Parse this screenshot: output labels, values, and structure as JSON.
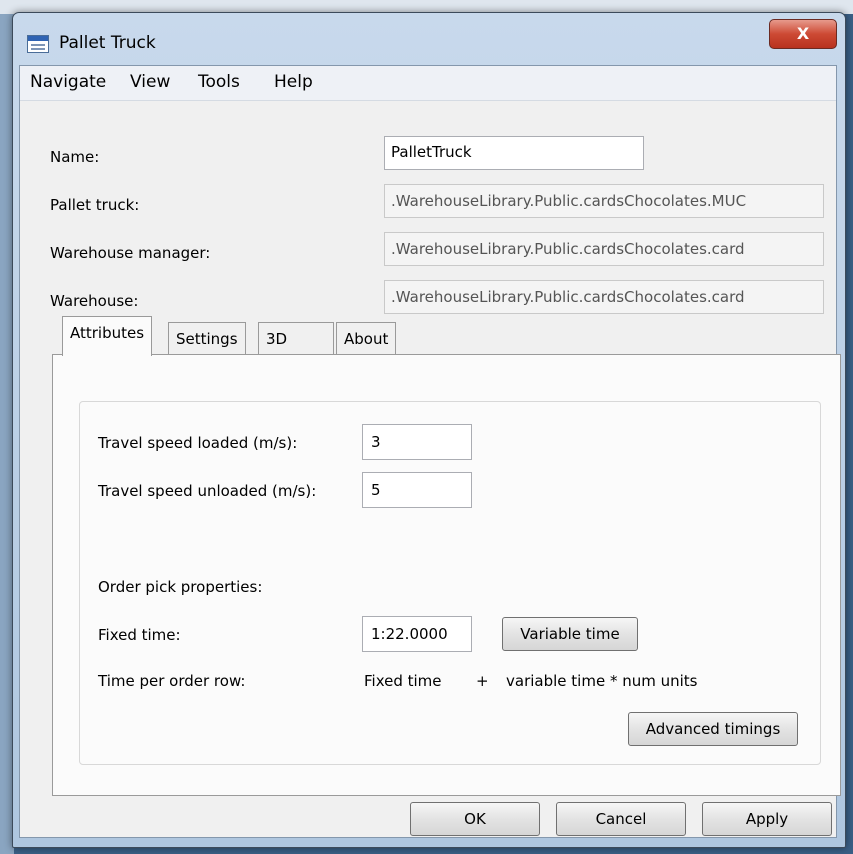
{
  "window": {
    "title": "Pallet Truck",
    "close_glyph": "X"
  },
  "menu": [
    "Navigate",
    "View",
    "Tools",
    "Help"
  ],
  "fields": {
    "name": {
      "label": "Name:",
      "value": "PalletTruck"
    },
    "pallet_truck": {
      "label": "Pallet truck:",
      "value": ".WarehouseLibrary.Public.cardsChocolates.MUC"
    },
    "warehouse_manager": {
      "label": "Warehouse manager:",
      "value": ".WarehouseLibrary.Public.cardsChocolates.card"
    },
    "warehouse": {
      "label": "Warehouse:",
      "value": ".WarehouseLibrary.Public.cardsChocolates.card"
    }
  },
  "tabs": [
    {
      "label": "Attributes",
      "active": true
    },
    {
      "label": "Settings",
      "active": false
    },
    {
      "label": "3D",
      "active": false
    },
    {
      "label": "About",
      "active": false
    }
  ],
  "attributes": {
    "speed_loaded": {
      "label": "Travel speed loaded (m/s):",
      "value": "3"
    },
    "speed_unloaded": {
      "label": "Travel speed unloaded (m/s):",
      "value": "5"
    },
    "order_pick_label": "Order pick properties:",
    "fixed_time": {
      "label": "Fixed time:",
      "value": "1:22.0000"
    },
    "variable_time_button": "Variable time",
    "time_per_order_row": {
      "label": "Time per order row:",
      "formula_part1": "Fixed time",
      "formula_plus": "+",
      "formula_part2": "variable time * num units"
    },
    "advanced_timings_button": "Advanced timings"
  },
  "buttons": {
    "ok": "OK",
    "cancel": "Cancel",
    "apply": "Apply"
  }
}
